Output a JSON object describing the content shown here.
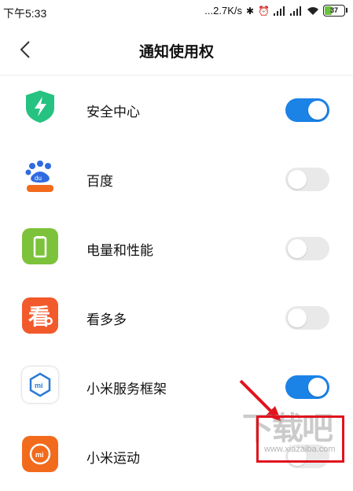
{
  "status_bar": {
    "time": "下午5:33",
    "network_speed": "...2.7K/s",
    "battery_level": "37"
  },
  "header": {
    "title": "通知使用权"
  },
  "apps": [
    {
      "name": "安全中心",
      "enabled": true,
      "icon": "shield-lightning-icon"
    },
    {
      "name": "百度",
      "enabled": false,
      "icon": "baidu-paw-icon"
    },
    {
      "name": "电量和性能",
      "enabled": false,
      "icon": "battery-icon"
    },
    {
      "name": "看多多",
      "enabled": false,
      "icon": "kanduoduo-icon"
    },
    {
      "name": "小米服务框架",
      "enabled": true,
      "icon": "mi-service-icon"
    },
    {
      "name": "小米运动",
      "enabled": false,
      "icon": "mi-fit-icon"
    }
  ],
  "colors": {
    "toggle_on": "#1b82e6",
    "toggle_off": "#e9e9e9",
    "annotation": "#e0141e"
  },
  "watermark": {
    "text": "下载吧",
    "url": "www.xiazaiba.com"
  }
}
